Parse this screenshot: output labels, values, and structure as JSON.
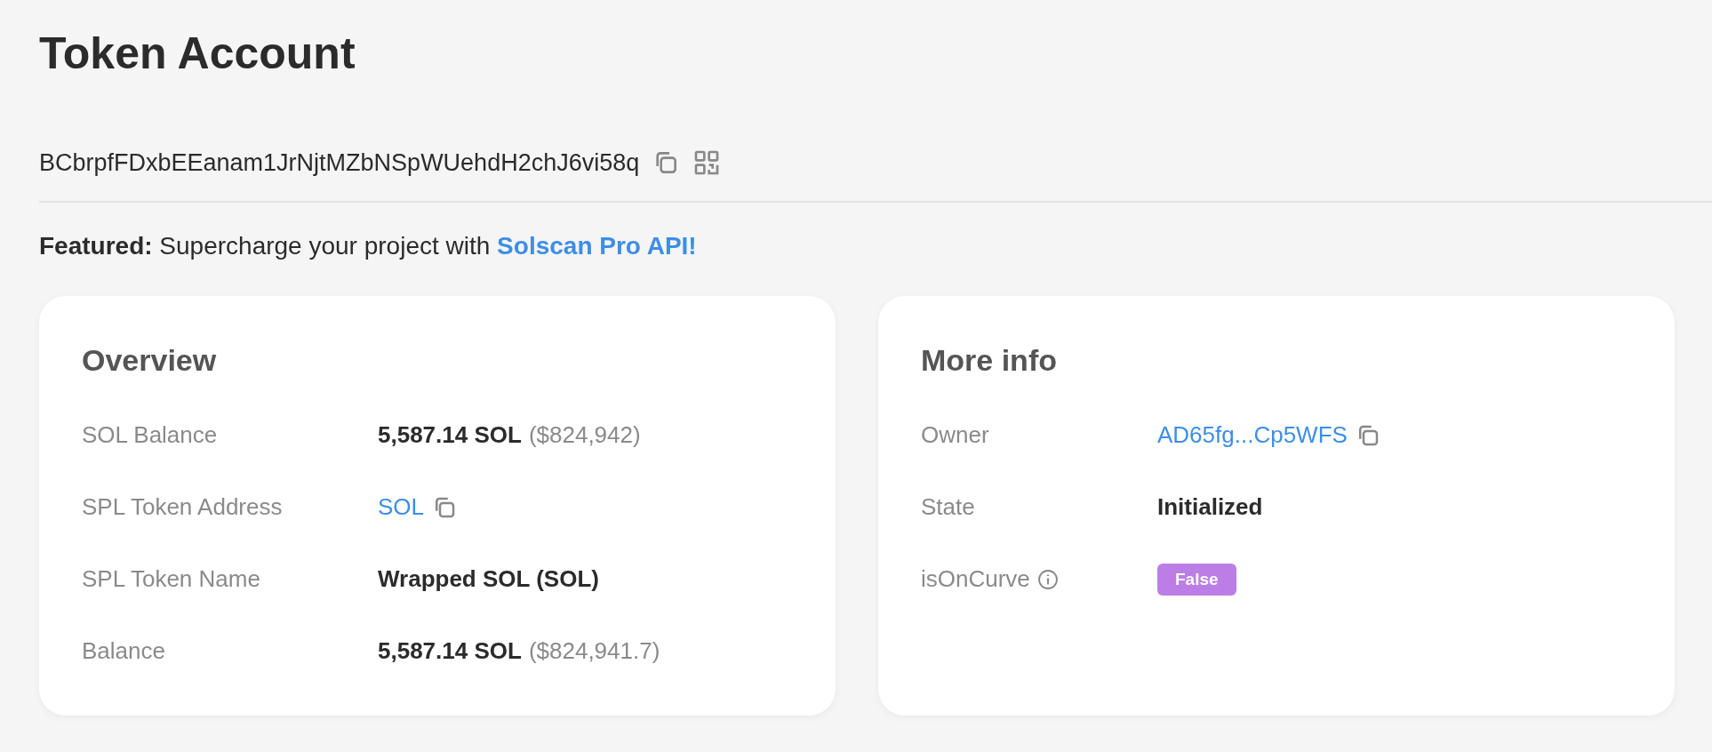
{
  "title": "Token Account",
  "address": {
    "text": "BCbrpfFDxbEEanam1JrNjtMZbNSpWUehdH2chJ6vi58q"
  },
  "featured": {
    "label": "Featured:",
    "text": "Supercharge your project with",
    "link": "Solscan Pro API!"
  },
  "cards": [
    {
      "title": "Overview",
      "rows": [
        {
          "label": "SOL Balance",
          "kind": "amount",
          "value": "5,587.14 SOL",
          "extra": "($824,942)"
        },
        {
          "label": "SPL Token Address",
          "kind": "link",
          "value": "SOL"
        },
        {
          "label": "SPL Token Name",
          "kind": "bold",
          "value": "Wrapped SOL (SOL)"
        },
        {
          "label": "Balance",
          "kind": "amount",
          "value": "5,587.14 SOL",
          "extra": "($824,941.7)"
        }
      ]
    },
    {
      "title": "More info",
      "rows": [
        {
          "label": "Owner",
          "kind": "link",
          "value": "AD65fg...Cp5WFS"
        },
        {
          "label": "State",
          "kind": "bold",
          "value": "Initialized"
        },
        {
          "label": "isOnCurve",
          "info": true,
          "kind": "badge",
          "value": "False",
          "color": "#bb7ee6"
        }
      ]
    }
  ]
}
